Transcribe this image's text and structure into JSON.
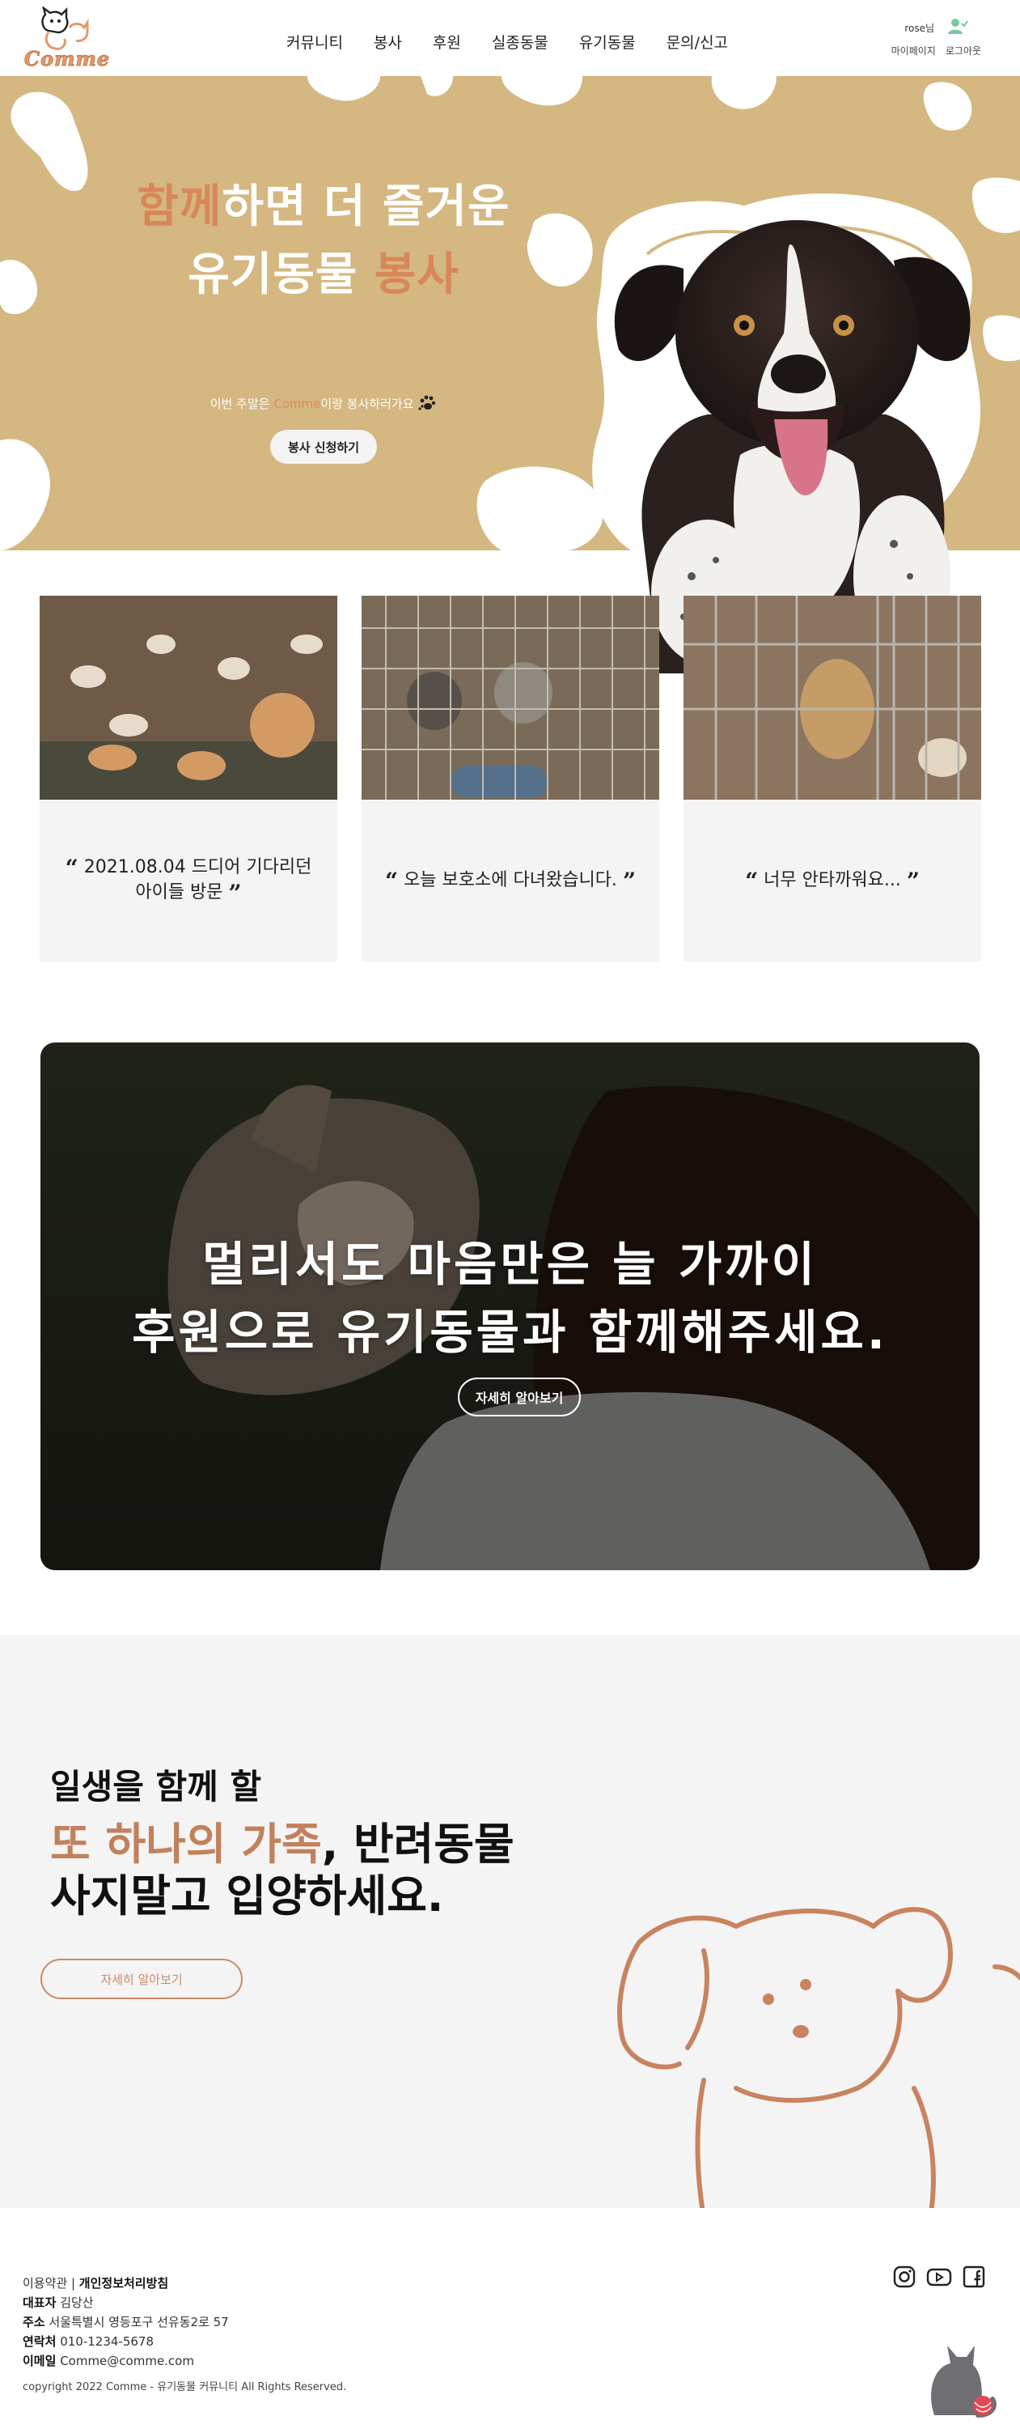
{
  "header": {
    "logo_text": "Comme",
    "nav": [
      "커뮤니티",
      "봉사",
      "후원",
      "실종동물",
      "유기동물",
      "문의/신고"
    ],
    "user_name": "rose님",
    "user_links": [
      "마이페이지",
      "로그아웃"
    ]
  },
  "hero": {
    "title_line1_accent": "함께",
    "title_line1_rest": "하면 더 즐거운",
    "title_line2_rest": "유기동물 ",
    "title_line2_accent": "봉사",
    "sub_before": "이번 주말은 ",
    "sub_accent": "Comme",
    "sub_after": "이랑 봉사하러가요",
    "button": "봉사 신청하기"
  },
  "cards": [
    {
      "text": "2021.08.04 드디어 기다리던 아이들 방문"
    },
    {
      "text": "오늘 보호소에 다녀왔습니다."
    },
    {
      "text": "너무 안타까워요..."
    }
  ],
  "banner": {
    "line1": "멀리서도 마음만은 늘 가까이",
    "line2": "후원으로 유기동물과 함께해주세요.",
    "button": "자세히 알아보기"
  },
  "adopt": {
    "line1": "일생을 함께 할",
    "line2_accent": "또 하나의 가족",
    "line2_rest": ", 반려동물",
    "line3": "사지말고 입양하세요.",
    "button": "자세히 알아보기"
  },
  "footer": {
    "terms": "이용약관",
    "privacy": "개인정보처리방침",
    "rep_label": "대표자",
    "rep_value": "김당산",
    "addr_label": "주소",
    "addr_value": "서울특별시 영등포구 선유동2로 57",
    "tel_label": "연락처",
    "tel_value": "010-1234-5678",
    "email_label": "이메일",
    "email_value": "Comme@comme.com",
    "copyright": "copyright 2022 Comme - 유기동물 커뮤니티 All Rights Reserved.",
    "sns": [
      "instagram-icon",
      "youtube-icon",
      "facebook-icon"
    ]
  },
  "colors": {
    "accent": "#d98758",
    "hero_bg": "#d4b781",
    "panel_bg": "#f4f4f4"
  }
}
